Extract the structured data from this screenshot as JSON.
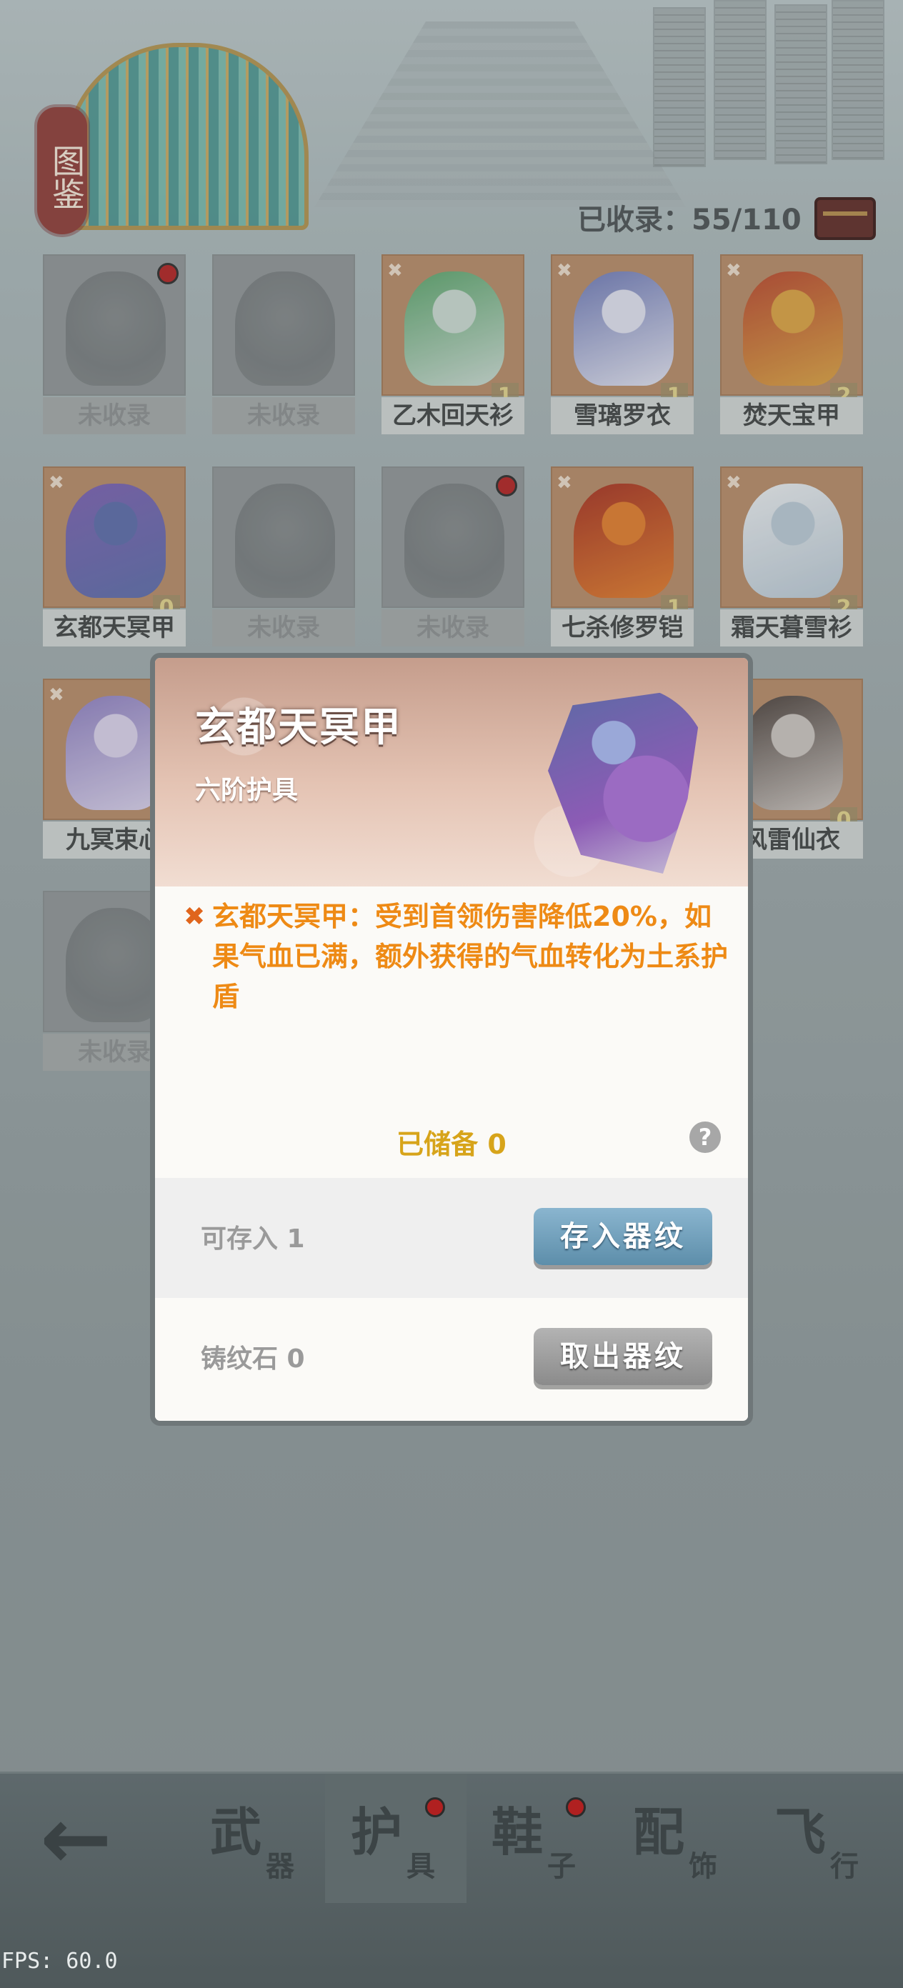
{
  "header": {
    "badge": "图鉴",
    "collected": "已收录：55/110"
  },
  "items": [
    {
      "name": "未收录",
      "locked": true,
      "dot": true,
      "count": "",
      "colors": [
        "#888",
        "#777"
      ]
    },
    {
      "name": "未收录",
      "locked": true,
      "dot": false,
      "count": "",
      "colors": [
        "#888",
        "#777"
      ]
    },
    {
      "name": "乙木回天衫",
      "locked": false,
      "dot": false,
      "count": "1",
      "colors": [
        "#5aa36a",
        "#c8d8d0"
      ]
    },
    {
      "name": "雪璃罗衣",
      "locked": false,
      "dot": false,
      "count": "1",
      "colors": [
        "#6d78b5",
        "#dfe0ee"
      ]
    },
    {
      "name": "焚天宝甲",
      "locked": false,
      "dot": false,
      "count": "2",
      "colors": [
        "#b8462c",
        "#d9a040"
      ]
    },
    {
      "name": "玄都天冥甲",
      "locked": false,
      "dot": false,
      "count": "0",
      "colors": [
        "#7a5fb0",
        "#5a6aa8"
      ]
    },
    {
      "name": "未收录",
      "locked": true,
      "dot": false,
      "count": "",
      "colors": [
        "#888",
        "#777"
      ]
    },
    {
      "name": "未收录",
      "locked": true,
      "dot": true,
      "count": "",
      "colors": [
        "#888",
        "#777"
      ]
    },
    {
      "name": "七杀修罗铠",
      "locked": false,
      "dot": false,
      "count": "1",
      "colors": [
        "#a5301f",
        "#e07a2a"
      ]
    },
    {
      "name": "霜天暮雪衫",
      "locked": false,
      "dot": false,
      "count": "2",
      "colors": [
        "#e9ecef",
        "#b8c7d3"
      ]
    },
    {
      "name": "九冥束心",
      "locked": false,
      "dot": false,
      "count": "",
      "colors": [
        "#8d7ec0",
        "#d8d0ea"
      ]
    },
    {
      "name": "风雷仙衣",
      "locked": false,
      "dot": false,
      "count": "0",
      "colors": [
        "#4a3f3a",
        "#c9c2bd"
      ]
    },
    {
      "name": "未收录",
      "locked": true,
      "dot": false,
      "count": "",
      "colors": [
        "#888",
        "#777"
      ]
    }
  ],
  "modal": {
    "title": "玄都天冥甲",
    "subtitle": "六阶护具",
    "description": "玄都天冥甲：受到首领伤害降低20%，如果气血已满，额外获得的气血转化为土系护盾",
    "stored": "已储备 0",
    "help": "?",
    "deposit_label": "可存入 1",
    "deposit_button": "存入器纹",
    "stone_label": "铸纹石 0",
    "withdraw_button": "取出器纹"
  },
  "tabs": [
    {
      "big": "武",
      "small": "器",
      "dot": false,
      "active": false
    },
    {
      "big": "护",
      "small": "具",
      "dot": true,
      "active": true
    },
    {
      "big": "鞋",
      "small": "子",
      "dot": true,
      "active": false
    },
    {
      "big": "配",
      "small": "饰",
      "dot": false,
      "active": false
    },
    {
      "big": "飞",
      "small": "行",
      "dot": false,
      "active": false
    }
  ],
  "back_icon": "back-arrow-icon",
  "fps": "FPS: 60.0"
}
